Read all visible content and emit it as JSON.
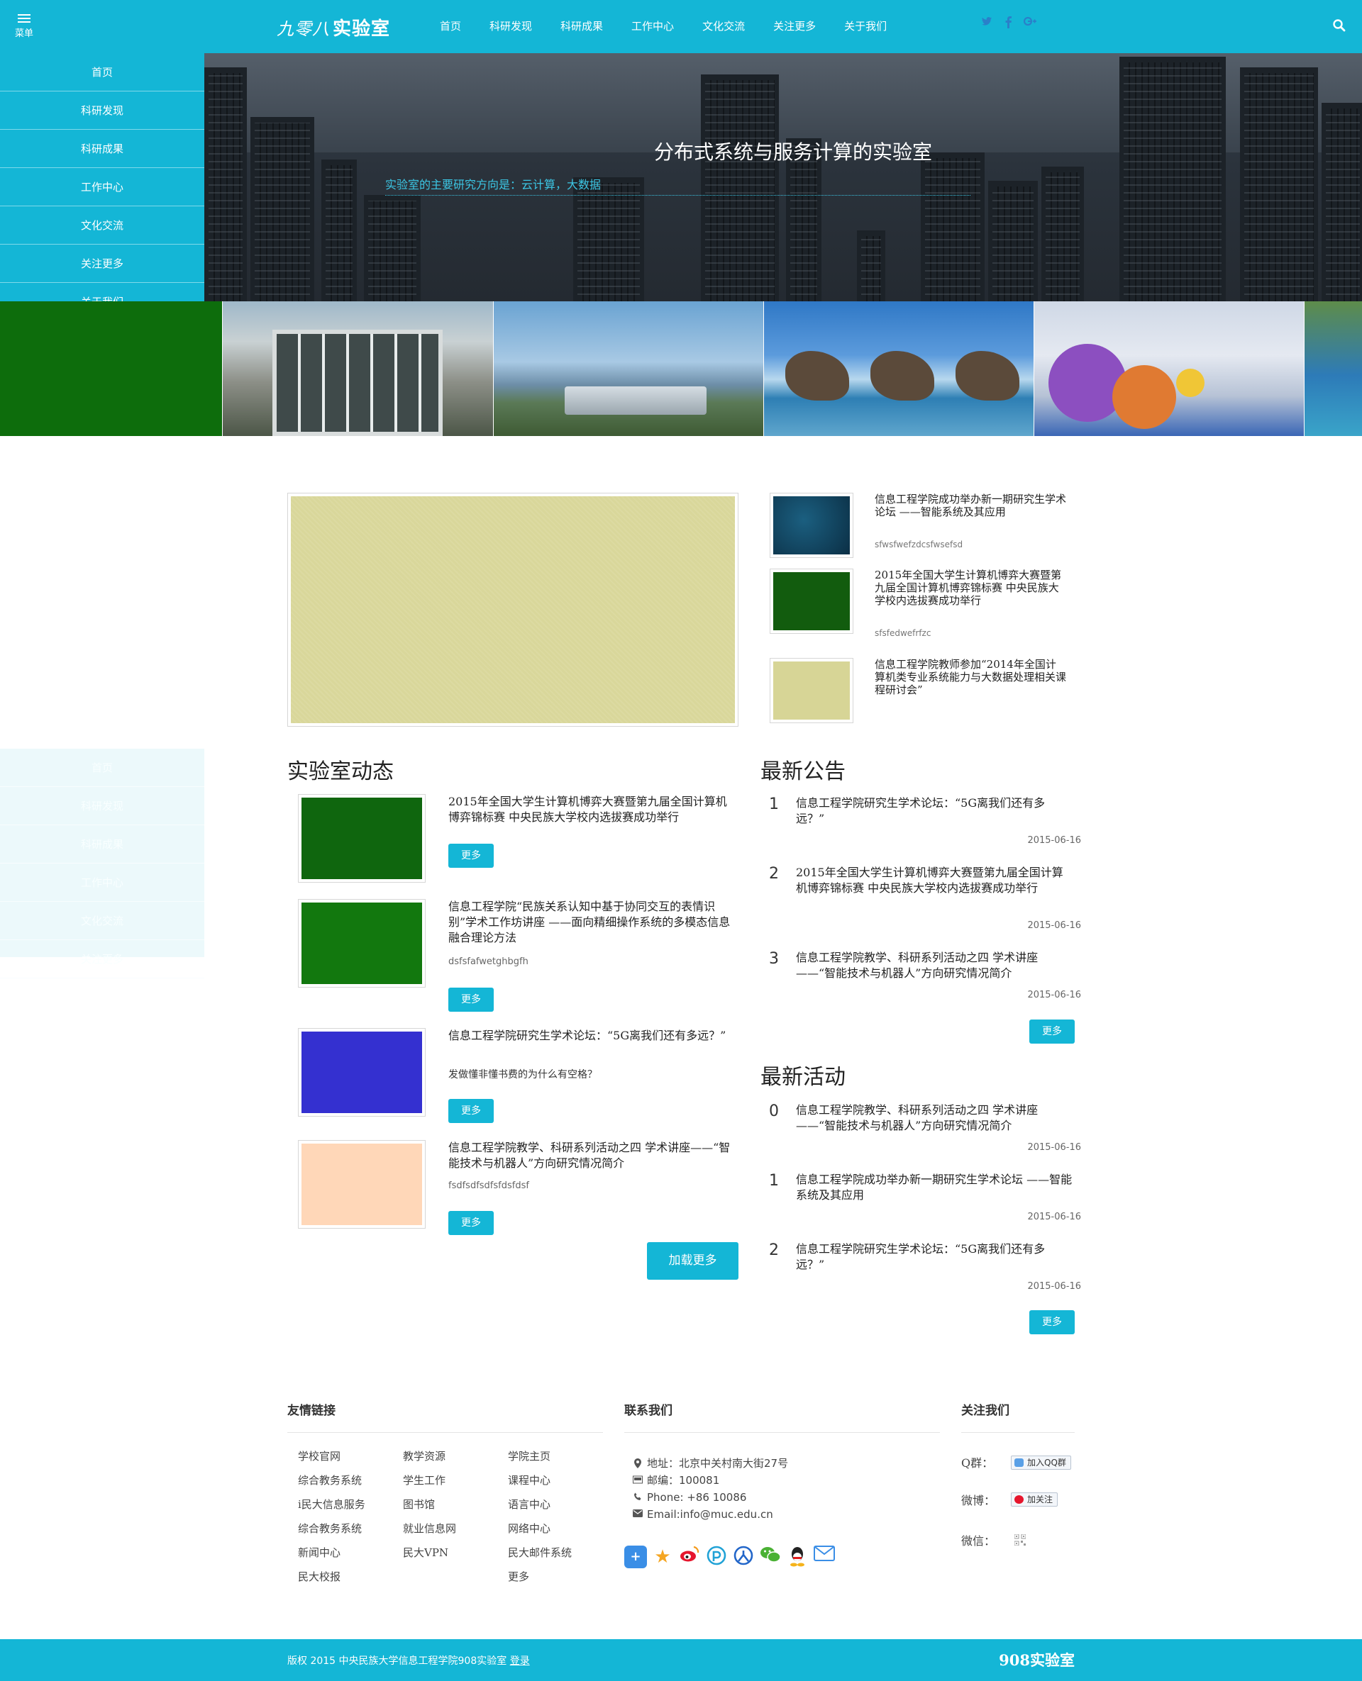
{
  "header": {
    "menu_label": "菜单",
    "logo_script": "九零八",
    "logo_text": "实验室",
    "nav": [
      "首页",
      "科研发现",
      "科研成果",
      "工作中心",
      "文化交流",
      "关注更多",
      "关于我们"
    ],
    "social_icons": [
      "twitter-icon",
      "facebook-icon",
      "google-plus-icon"
    ],
    "search_icon": "search-icon"
  },
  "sidemenu": [
    "首页",
    "科研发现",
    "科研成果",
    "工作中心",
    "文化交流",
    "关注更多",
    "关于我们"
  ],
  "hero": {
    "title": "分布式系统与服务计算的实验室",
    "subtitle": "实验室的主要研究方向是：云计算，大数据"
  },
  "featured": {
    "side": [
      {
        "title": "信息工程学院成功举办新一期研究生学术论坛 ——智能系统及其应用",
        "summary": "sfwsfwefzdcsfwsefsd",
        "color": "#10405a"
      },
      {
        "title": "2015年全国大学生计算机博弈大赛暨第九届全国计算机博弈锦标赛 中央民族大学校内选拔赛成功举行",
        "summary": "sfsfedwefrfzc",
        "color": "#125c0e"
      },
      {
        "title": "信息工程学院教师参加“2014年全国计算机类专业系统能力与大数据处理相关课程研讨会”",
        "summary": "",
        "color": "#d7d596"
      }
    ]
  },
  "lab_news": {
    "heading": "实验室动态",
    "more_label": "更多",
    "load_more": "加载更多",
    "items": [
      {
        "title": "2015年全国大学生计算机博弈大赛暨第九届全国计算机博弈锦标赛 中央民族大学校内选拔赛成功举行",
        "summary": "",
        "color": "#0f660e"
      },
      {
        "title": "信息工程学院“民族关系认知中基于协同交互的表情识别”学术工作坊讲座 ——面向精细操作系统的多模态信息融合理论方法",
        "summary": "dsfsfafwetghbgfh",
        "color": "#12780e"
      },
      {
        "title": "信息工程学院研究生学术论坛：“5G离我们还有多远？”",
        "summary": "发做懂非懂书费的为什么有空格？",
        "color": "#3430d0"
      },
      {
        "title": "信息工程学院教学、科研系列活动之四 学术讲座——“智能技术与机器人”方向研究情况简介",
        "summary": "fsdfsdfsdfsfdsfdsf",
        "color": "#ffd7b8"
      }
    ]
  },
  "announcements": {
    "heading": "最新公告",
    "more_label": "更多",
    "items": [
      {
        "num": "1",
        "title": "信息工程学院研究生学术论坛：“5G离我们还有多远？”",
        "date": "2015-06-16"
      },
      {
        "num": "2",
        "title": "2015年全国大学生计算机博弈大赛暨第九届全国计算机博弈锦标赛 中央民族大学校内选拔赛成功举行",
        "date": "2015-06-16"
      },
      {
        "num": "3",
        "title": "信息工程学院教学、科研系列活动之四 学术讲座——“智能技术与机器人”方向研究情况简介",
        "date": "2015-06-16"
      }
    ]
  },
  "activities": {
    "heading": "最新活动",
    "more_label": "更多",
    "items": [
      {
        "num": "0",
        "title": "信息工程学院教学、科研系列活动之四 学术讲座——“智能技术与机器人”方向研究情况简介",
        "date": "2015-06-16"
      },
      {
        "num": "1",
        "title": "信息工程学院成功举办新一期研究生学术论坛 ——智能系统及其应用",
        "date": "2015-06-16"
      },
      {
        "num": "2",
        "title": "信息工程学院研究生学术论坛：“5G离我们还有多远？”",
        "date": "2015-06-16"
      }
    ]
  },
  "footer": {
    "links_heading": "友情链接",
    "contact_heading": "联系我们",
    "follow_heading": "关注我们",
    "links": [
      "学校官网",
      "教学资源",
      "学院主页",
      "综合教务系统",
      "学生工作",
      "课程中心",
      "i民大信息服务",
      "图书馆",
      "语言中心",
      "综合教务系统",
      "就业信息网",
      "网络中心",
      "新闻中心",
      "民大VPN",
      "民大邮件系统",
      "民大校报",
      "",
      "更多"
    ],
    "contact": {
      "address": "地址：北京中关村南大街27号",
      "postcode": "邮编：100081",
      "phone": "Phone: +86 10086",
      "email": "Email:info@muc.edu.cn"
    },
    "share_icons": [
      "add-share-icon",
      "qzone-icon",
      "weibo-icon",
      "pengyou-icon",
      "renren-icon",
      "wechat-icon",
      "qq-icon",
      "mail-icon"
    ],
    "qq_label": "Q群：",
    "qq_button": "加入QQ群",
    "weibo_label": "微博：",
    "weibo_button": "加关注",
    "wechat_label": "微信：",
    "copyright": "版权 2015 中央民族大学信息工程学院908实验室",
    "login": "登录",
    "bottom_logo": "908实验室"
  },
  "colors": {
    "accent": "#14b6d6",
    "green": "#0d6d0c"
  }
}
